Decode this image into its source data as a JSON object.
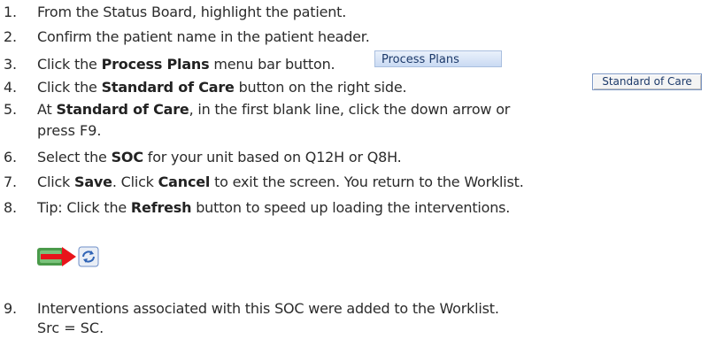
{
  "steps": [
    {
      "num": "1.",
      "parts": [
        {
          "t": "From the Status Board, highlight the patient."
        }
      ]
    },
    {
      "num": "2.",
      "parts": [
        {
          "t": "Confirm the patient name in the patient header."
        }
      ]
    },
    {
      "num": "3.",
      "parts": [
        {
          "t": "Click the "
        },
        {
          "t": "Process Plans",
          "b": true
        },
        {
          "t": " menu bar button."
        }
      ]
    },
    {
      "num": "4.",
      "parts": [
        {
          "t": "Click the "
        },
        {
          "t": "Standard of Care",
          "b": true
        },
        {
          "t": " button on the right side."
        }
      ]
    },
    {
      "num": "5.",
      "parts": [
        {
          "t": "At "
        },
        {
          "t": "Standard of Care",
          "b": true
        },
        {
          "t": ", in the first blank line, click the down arrow or"
        }
      ],
      "cont": "press F9."
    },
    {
      "num": "6.",
      "parts": [
        {
          "t": "Select the "
        },
        {
          "t": "SOC",
          "b": true
        },
        {
          "t": " for your unit based on Q12H or Q8H."
        }
      ]
    },
    {
      "num": "7.",
      "parts": [
        {
          "t": "Click "
        },
        {
          "t": "Save",
          "b": true
        },
        {
          "t": ". Click "
        },
        {
          "t": "Cancel",
          "b": true
        },
        {
          "t": " to exit the screen. You return to the Worklist."
        }
      ]
    },
    {
      "num": "8.",
      "parts": [
        {
          "t": "Tip: Click the "
        },
        {
          "t": "Refresh",
          "b": true
        },
        {
          "t": " button to speed up loading the interventions."
        }
      ]
    },
    {
      "num": "9.",
      "parts": [
        {
          "t": "Interventions associated with this SOC were added to the Worklist."
        }
      ],
      "cont": "Src = SC."
    }
  ],
  "buttons": {
    "process_plans": "Process Plans",
    "standard_of_care": "Standard of Care"
  },
  "icons": {
    "refresh": "refresh-icon",
    "arrow": "red-arrow-icon"
  },
  "colors": {
    "arrow": "#e8141b",
    "refresh_bg": "#e9eef6",
    "refresh_fg": "#2f63b5"
  }
}
